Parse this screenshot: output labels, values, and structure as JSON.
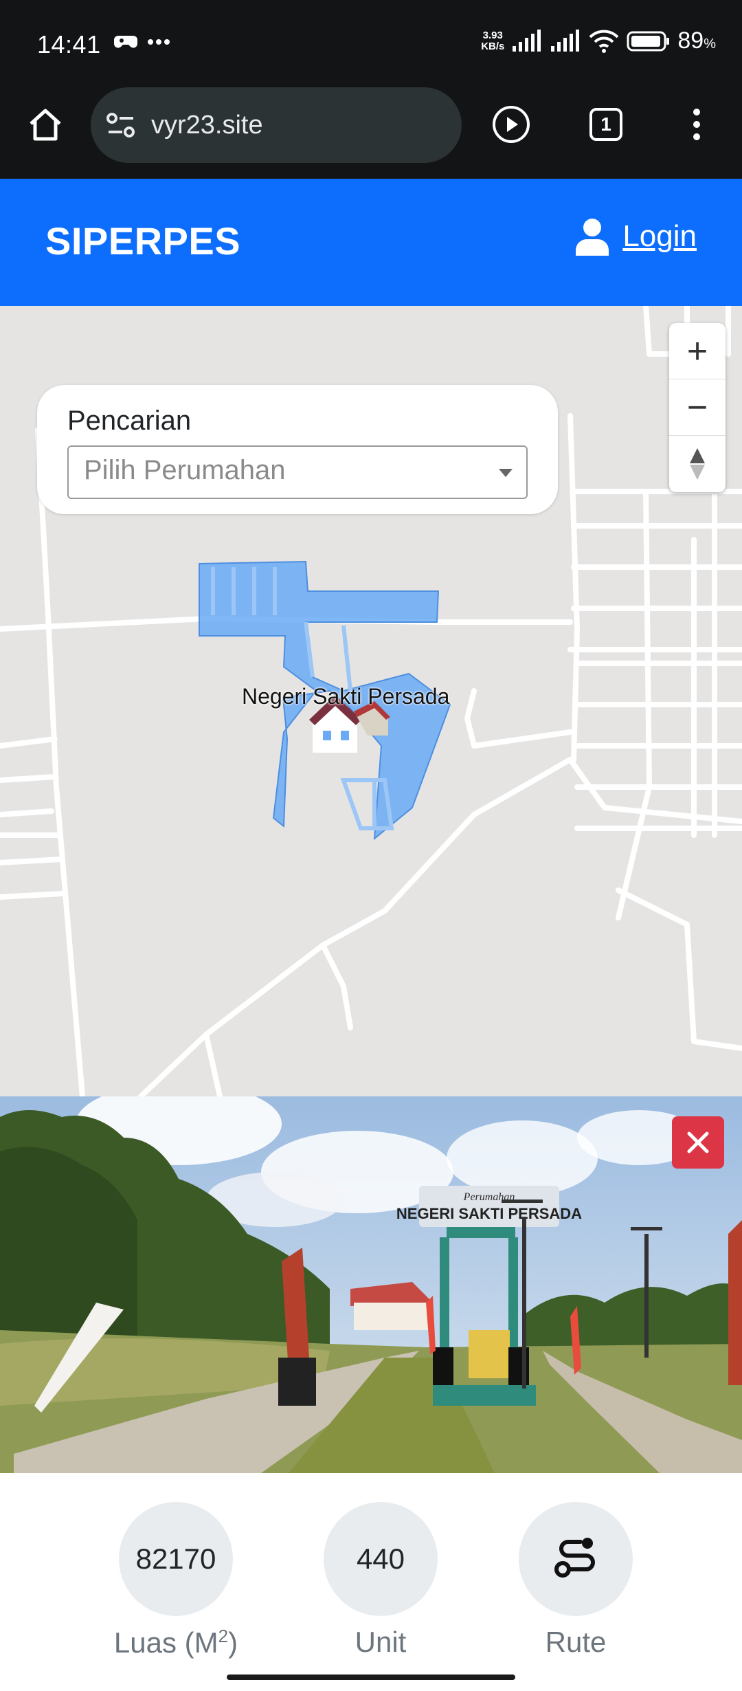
{
  "status_bar": {
    "time": "14:41",
    "net_speed_value": "3.93",
    "net_speed_unit": "KB/s",
    "battery": "89",
    "battery_unit": "%"
  },
  "browser": {
    "url": "vyr23.site",
    "tab_count": "1"
  },
  "header": {
    "brand": "SIPERPES",
    "login_label": "Login"
  },
  "map": {
    "search_title": "Pencarian",
    "select_placeholder": "Pilih Perumahan",
    "place_label": "Negeri Sakti Persada",
    "zoom_in": "+",
    "zoom_out": "−",
    "polygon_color": "#6aaaf4",
    "background_color": "#e5e4e2",
    "road_color": "#ffffff"
  },
  "photo": {
    "sign_top": "Perumahan",
    "sign_main": "NEGERI SAKTI PERSADA"
  },
  "stats": {
    "area_value": "82170",
    "area_label": "Luas (M",
    "area_label_sup": "2",
    "area_label_end": ")",
    "unit_value": "440",
    "unit_label": "Unit",
    "route_label": "Rute"
  },
  "colors": {
    "header": "#0d6efd",
    "close_button": "#dc3545",
    "stat_circle": "#e9ecef"
  }
}
